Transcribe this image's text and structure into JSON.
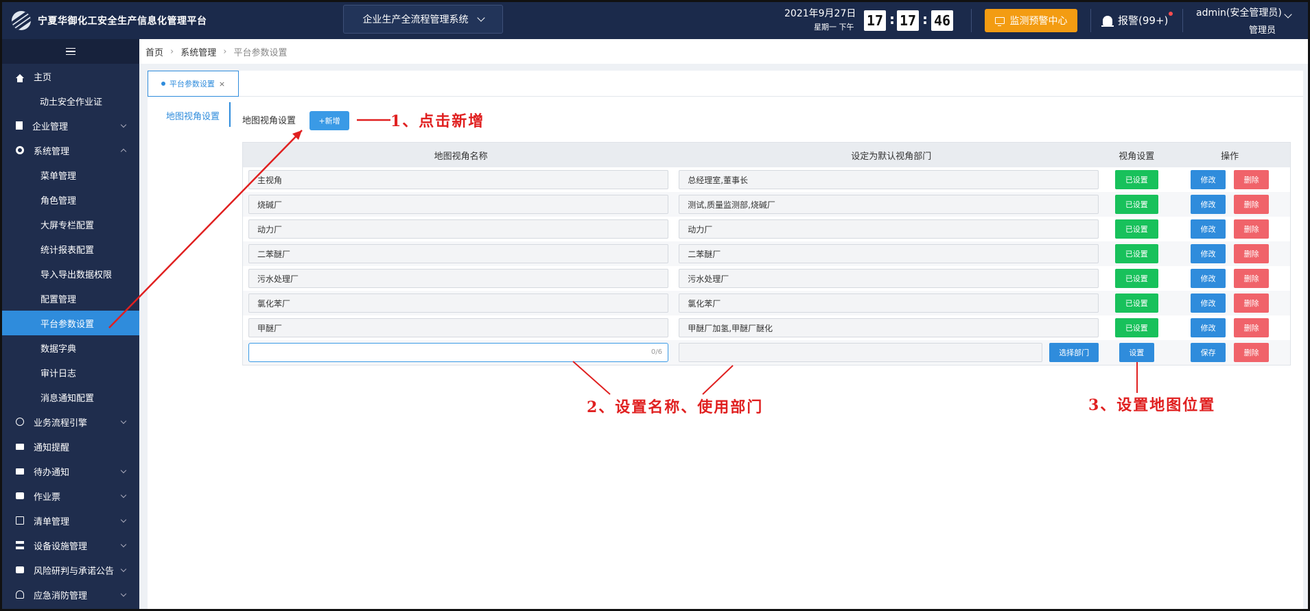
{
  "header": {
    "app_title": "宁夏华御化工安全生产信息化管理平台",
    "system_select": "企业生产全流程管理系统",
    "date": "2021年9月27日",
    "weekday": "星期一  下午",
    "clock": {
      "hour": "17",
      "minute": "17",
      "second": "46"
    },
    "monitor_button": "监测预警中心",
    "alarm": "报警(99+)",
    "user_name": "admin(安全管理员)",
    "user_role": "管理员",
    "colors": {
      "header_bg": "#1b2a4b",
      "monitor_btn": "#f39c12"
    }
  },
  "sidebar": {
    "items": [
      {
        "label": "主页",
        "icon": "home-icon",
        "level": 0
      },
      {
        "label": "动土安全作业证",
        "level": 1
      },
      {
        "label": "企业管理",
        "icon": "building-icon",
        "level": 0,
        "expandable": true
      },
      {
        "label": "系统管理",
        "icon": "gear-icon",
        "level": 0,
        "expanded": true
      },
      {
        "label": "菜单管理",
        "level": 2
      },
      {
        "label": "角色管理",
        "level": 2
      },
      {
        "label": "大屏专栏配置",
        "level": 2
      },
      {
        "label": "统计报表配置",
        "level": 2
      },
      {
        "label": "导入导出数据权限",
        "level": 2
      },
      {
        "label": "配置管理",
        "level": 2
      },
      {
        "label": "平台参数设置",
        "level": 2,
        "active": true
      },
      {
        "label": "数据字典",
        "level": 2
      },
      {
        "label": "审计日志",
        "level": 2
      },
      {
        "label": "消息通知配置",
        "level": 2
      },
      {
        "label": "业务流程引擎",
        "icon": "globe-icon",
        "level": 0,
        "expandable": true
      },
      {
        "label": "通知提醒",
        "icon": "mail-icon",
        "level": 0
      },
      {
        "label": "待办通知",
        "icon": "mail-icon",
        "level": 0,
        "expandable": true
      },
      {
        "label": "作业票",
        "icon": "ticket-icon",
        "level": 0,
        "expandable": true
      },
      {
        "label": "清单管理",
        "icon": "list-icon",
        "level": 0,
        "expandable": true
      },
      {
        "label": "设备设施管理",
        "icon": "tree-icon",
        "level": 0,
        "expandable": true
      },
      {
        "label": "风险研判与承诺公告",
        "icon": "briefcase-icon",
        "level": 0,
        "expandable": true
      },
      {
        "label": "应急消防管理",
        "icon": "extinguisher-icon",
        "level": 0,
        "expandable": true
      }
    ]
  },
  "breadcrumb": {
    "home": "首页",
    "parent": "系统管理",
    "current": "平台参数设置"
  },
  "tab": {
    "label": "平台参数设置",
    "close": "×"
  },
  "side_menu": {
    "item": "地图视角设置"
  },
  "section": {
    "title": "地图视角设置",
    "add_button": "+新增"
  },
  "table": {
    "headers": [
      "地图视角名称",
      "设定为默认视角部门",
      "视角设置",
      "操作"
    ],
    "rows": [
      {
        "name": "主视角",
        "dept": "总经理室,董事长",
        "view": "已设置"
      },
      {
        "name": "烧碱厂",
        "dept": "测试,质量监测部,烧碱厂",
        "view": "已设置"
      },
      {
        "name": "动力厂",
        "dept": "动力厂",
        "view": "已设置"
      },
      {
        "name": "二苯醚厂",
        "dept": "二苯醚厂",
        "view": "已设置"
      },
      {
        "name": "污水处理厂",
        "dept": "污水处理厂",
        "view": "已设置"
      },
      {
        "name": "氯化苯厂",
        "dept": "氯化苯厂",
        "view": "已设置"
      },
      {
        "name": "甲醚厂",
        "dept": "甲醚厂加氢,甲醚厂醚化",
        "view": "已设置"
      }
    ],
    "edit_label": "修改",
    "delete_label": "删除",
    "new_row": {
      "name_value": "",
      "name_count": "0/6",
      "dept_value": "",
      "select_dept_button": "选择部门",
      "set_button": "设置",
      "save_button": "保存",
      "delete_button": "删除"
    }
  },
  "annotations": {
    "step1": "1、点击新增",
    "step2": "2、设置名称、使用部门",
    "step3": "3、设置地图位置"
  }
}
